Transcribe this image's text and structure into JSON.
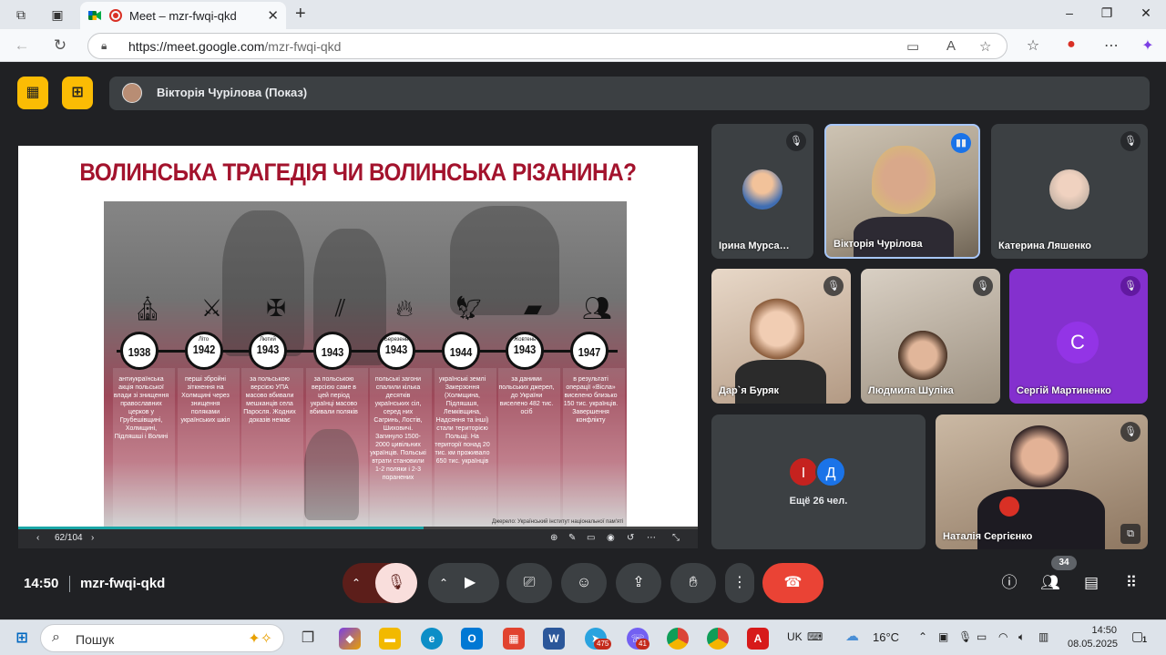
{
  "browser": {
    "tab_title": "Meet – mzr-fwqi-qkd",
    "new_tab": "+",
    "url_host": "https://meet.google.com",
    "url_path": "/mzr-fwqi-qkd",
    "window_controls": [
      "–",
      "❐",
      "✕"
    ]
  },
  "meet": {
    "presenter_label": "Вікторія Чурілова (Показ)",
    "slide": {
      "title": "ВОЛИНСЬКА ТРАГЕДІЯ ЧИ ВОЛИНСЬКА РІЗАНИНА?",
      "page": "62/104",
      "timeline": [
        {
          "season": "",
          "year": "1938",
          "icon": "church-icon",
          "text": "антиукраїнська акція польської влади зі знищення православних церков у Грубешівщині, Холмщині, Підляшші і Волині"
        },
        {
          "season": "Літо",
          "year": "1942",
          "icon": "rifle-icon",
          "text": "перші збройні зіткнення на Холмщині через знищення поляками українських шкіл"
        },
        {
          "season": "Лютий",
          "year": "1943",
          "icon": "trident-cross-icon",
          "text": "за польською версією УПА масово вбивали мешканців села Паросля. Жодних доказів немає"
        },
        {
          "season": "",
          "year": "1943",
          "icon": "knives-icon",
          "text": "за польською версією саме в цей період українці масово вбивали поляків"
        },
        {
          "season": "Березень",
          "year": "1943",
          "icon": "flame-icon",
          "text": "польські загони спалили кілька десятків українських сіл, серед них Сагринь, Лостів, Шиховичі. Загинуло 1500-2000 цивільних українців. Польські втрати становили 1-2 поляки і 2-3 поранених"
        },
        {
          "season": "",
          "year": "1944",
          "icon": "eagle-icon",
          "text": "українські землі Закерзоння (Холмщина, Підляшшя, Лемківщина, Надсяння та інші) стали територією Польщі. На території понад 20 тис. км проживало 650 тис. українців"
        },
        {
          "season": "Жовтень",
          "year": "1943",
          "icon": "map-icon",
          "text": "за даними польських джерел, до України виселено 482 тис. осіб"
        },
        {
          "season": "",
          "year": "1947",
          "icon": "people-icon",
          "text": "в результаті операції «Вісла» виселено близько 150 тис. українців. Завершення конфлікту"
        }
      ],
      "caption": "Джерело: Український інститут національної пам'яті"
    },
    "tiles": [
      {
        "name": "Ірина Мурса…",
        "muted": true,
        "type": "avatar"
      },
      {
        "name": "Вікторія Чурілова",
        "muted": false,
        "type": "camera",
        "speaking": true
      },
      {
        "name": "Катерина Ляшенко",
        "muted": true,
        "type": "avatar"
      },
      {
        "name": "Дар`я Буряк",
        "muted": true,
        "type": "camera"
      },
      {
        "name": "Людмила Шуліка",
        "muted": true,
        "type": "camera"
      },
      {
        "name": "Сергій Мартиненко",
        "muted": true,
        "type": "letter",
        "letter": "С",
        "color": "#8430ce"
      },
      {
        "name": "Наталія Сергієнко",
        "muted": true,
        "type": "camera"
      }
    ],
    "others": {
      "initial_1": "І",
      "initial_2": "Д",
      "label": "Ещё 26 чел."
    },
    "controls": {
      "time": "14:50",
      "meeting_code": "mzr-fwqi-qkd",
      "participants_count": "34"
    }
  },
  "taskbar": {
    "search_label": "Пошук",
    "telegram_badge": "475",
    "viber_badge": "41",
    "lang": "UK",
    "temperature": "16°C",
    "time": "14:50",
    "date": "08.05.2025",
    "notifications": "1"
  },
  "colors": {
    "meet_bg": "#202124",
    "tile_bg": "#3c4043",
    "accent_yellow": "#fbbc04",
    "end_call_red": "#ea4335",
    "mic_off_red": "#f9dedc",
    "slide_title_red": "#a3132d"
  }
}
